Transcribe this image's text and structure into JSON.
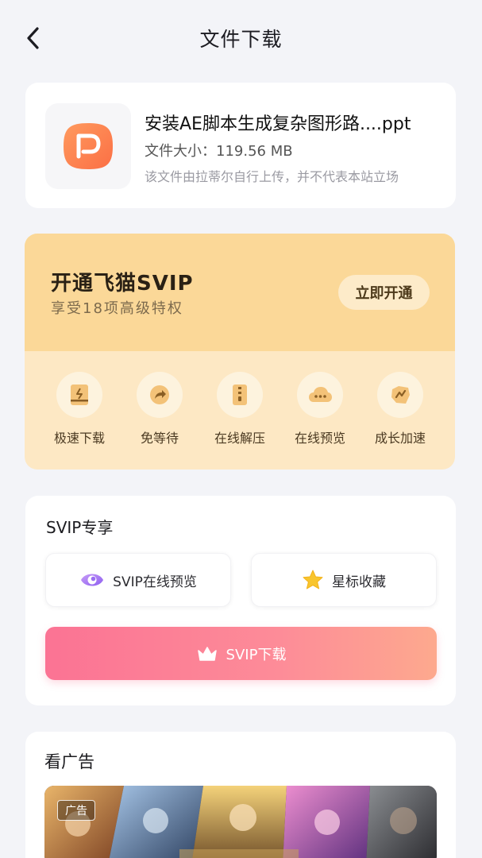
{
  "header": {
    "title": "文件下载",
    "back_icon": "chevron-left-icon"
  },
  "file": {
    "icon": "powerpoint-file-icon",
    "icon_color": "#fd7f4e",
    "name": "安装AE脚本生成复杂图形路....ppt",
    "size_label": "文件大小：",
    "size_value": "119.56 MB",
    "note": "该文件由拉蒂尔自行上传，并不代表本站立场"
  },
  "svip_promo": {
    "title": "开通飞猫SVIP",
    "subtitle": "享受18项高级特权",
    "open_button": "立即开通",
    "perks": [
      {
        "label": "极速下载",
        "icon": "fast-download-icon"
      },
      {
        "label": "免等待",
        "icon": "skip-wait-icon"
      },
      {
        "label": "在线解压",
        "icon": "zip-icon"
      },
      {
        "label": "在线预览",
        "icon": "cloud-preview-icon"
      },
      {
        "label": "成长加速",
        "icon": "growth-boost-icon"
      }
    ],
    "colors": {
      "top": "#fbd898",
      "bottom": "#fde8c4",
      "accent": "#d9a24f"
    }
  },
  "svip_exclusive": {
    "title": "SVIP专享",
    "preview_button": "SVIP在线预览",
    "favorite_button": "星标收藏",
    "download_button": "SVIP下载",
    "download_gradient": [
      "#fb7394",
      "#fda98e"
    ]
  },
  "ad": {
    "title": "看广告",
    "tag": "广告"
  }
}
